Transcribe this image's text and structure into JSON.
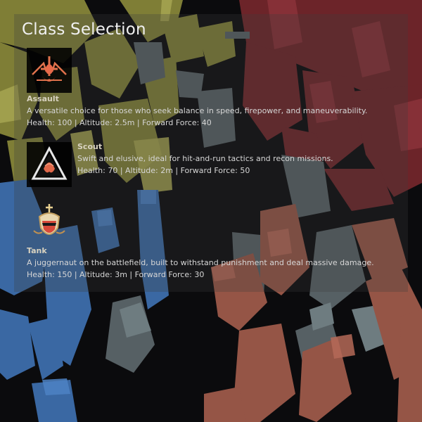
{
  "title": "Class Selection",
  "classes": [
    {
      "name": "Assault",
      "description": "A versatile choice for those who seek balance in speed, firepower, and maneuverability.",
      "stats": "Health: 100 | Altitude: 2.5m | Forward Force: 40",
      "icon": "assault-emblem-icon"
    },
    {
      "name": "Scout",
      "description": "Swift and elusive, ideal for hit-and-run tactics and recon missions.",
      "stats": "Health: 70 | Altitude: 2m | Forward Force: 50",
      "icon": "scout-emblem-icon"
    },
    {
      "name": "Tank",
      "description": "A juggernaut on the battlefield, built to withstand punishment and deal massive damage.",
      "stats": "Health: 150 | Altitude: 3m | Forward Force: 30",
      "icon": "tank-emblem-icon"
    }
  ],
  "colors": {
    "olive_blocks": "#8b8a3a",
    "red_blocks": "#7a2a30",
    "blue_blocks": "#3f6fae",
    "salmon_blocks": "#a05a48",
    "gray_blocks": "#5a6568",
    "emblem_accent": "#e06a4a"
  }
}
